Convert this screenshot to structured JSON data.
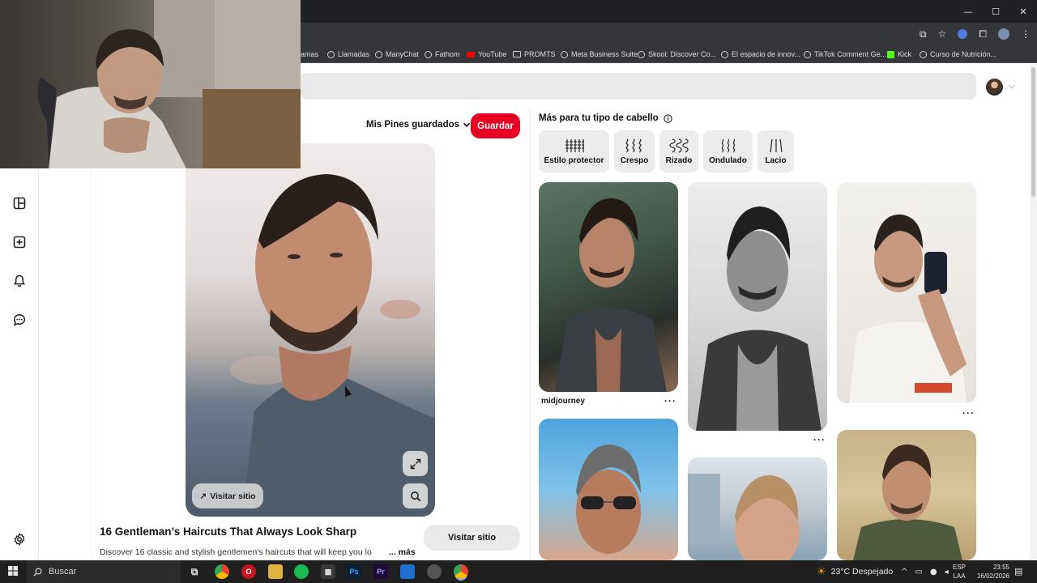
{
  "window": {
    "controls": [
      "—",
      "☐",
      "✕"
    ]
  },
  "bookmarks": [
    {
      "label": "amas",
      "icon": "none"
    },
    {
      "label": "Llamadas",
      "icon": "globe-icon"
    },
    {
      "label": "ManyChat",
      "icon": "globe-icon"
    },
    {
      "label": "Fathom",
      "icon": "globe-icon"
    },
    {
      "label": "YouTube",
      "icon": "youtube-icon"
    },
    {
      "label": "PROMTS",
      "icon": "folder-icon"
    },
    {
      "label": "Meta Business Suite",
      "icon": "globe-icon"
    },
    {
      "label": "Skool: Discover Co...",
      "icon": "globe-icon"
    },
    {
      "label": "El espacio de innov...",
      "icon": "globe-icon"
    },
    {
      "label": "TikTok Comment Ge...",
      "icon": "globe-icon"
    },
    {
      "label": "Kick",
      "icon": "kick-icon"
    },
    {
      "label": "Curso de Nutrición...",
      "icon": "globe-icon"
    }
  ],
  "main_pin": {
    "board_select": "Mis Pines guardados",
    "save_label": "Guardar",
    "visit_small": "Visitar sitio",
    "title": "16 Gentleman’s Haircuts That Always Look Sharp",
    "description": "Discover 16 classic and stylish gentlemen's haircuts that will keep you lo",
    "more": "... más",
    "visit_big": "Visitar sitio"
  },
  "related": {
    "heading": "Más para tu tipo de cabello",
    "chips": [
      {
        "label": "Estilo protector",
        "icon": "braids-icon"
      },
      {
        "label": "Crespo",
        "icon": "coily-icon"
      },
      {
        "label": "Rizado",
        "icon": "curly-icon"
      },
      {
        "label": "Ondulado",
        "icon": "wavy-icon"
      },
      {
        "label": "Lacio",
        "icon": "straight-icon"
      }
    ],
    "pins": [
      {
        "caption": "midjourney",
        "more": "···"
      },
      {
        "caption": "",
        "more": "···"
      },
      {
        "caption": "",
        "more": "···"
      }
    ]
  },
  "taskbar": {
    "search_placeholder": "Buscar",
    "weather": "23°C  Despejado",
    "lang_line1": "ESP",
    "lang_line2": "LAA",
    "time": "23:55",
    "date": "16/02/2026"
  },
  "colors": {
    "accent": "#e60023",
    "chrome_dark": "#202124",
    "chrome_toolbar": "#35363a",
    "taskbar": "#1f1f1f"
  }
}
